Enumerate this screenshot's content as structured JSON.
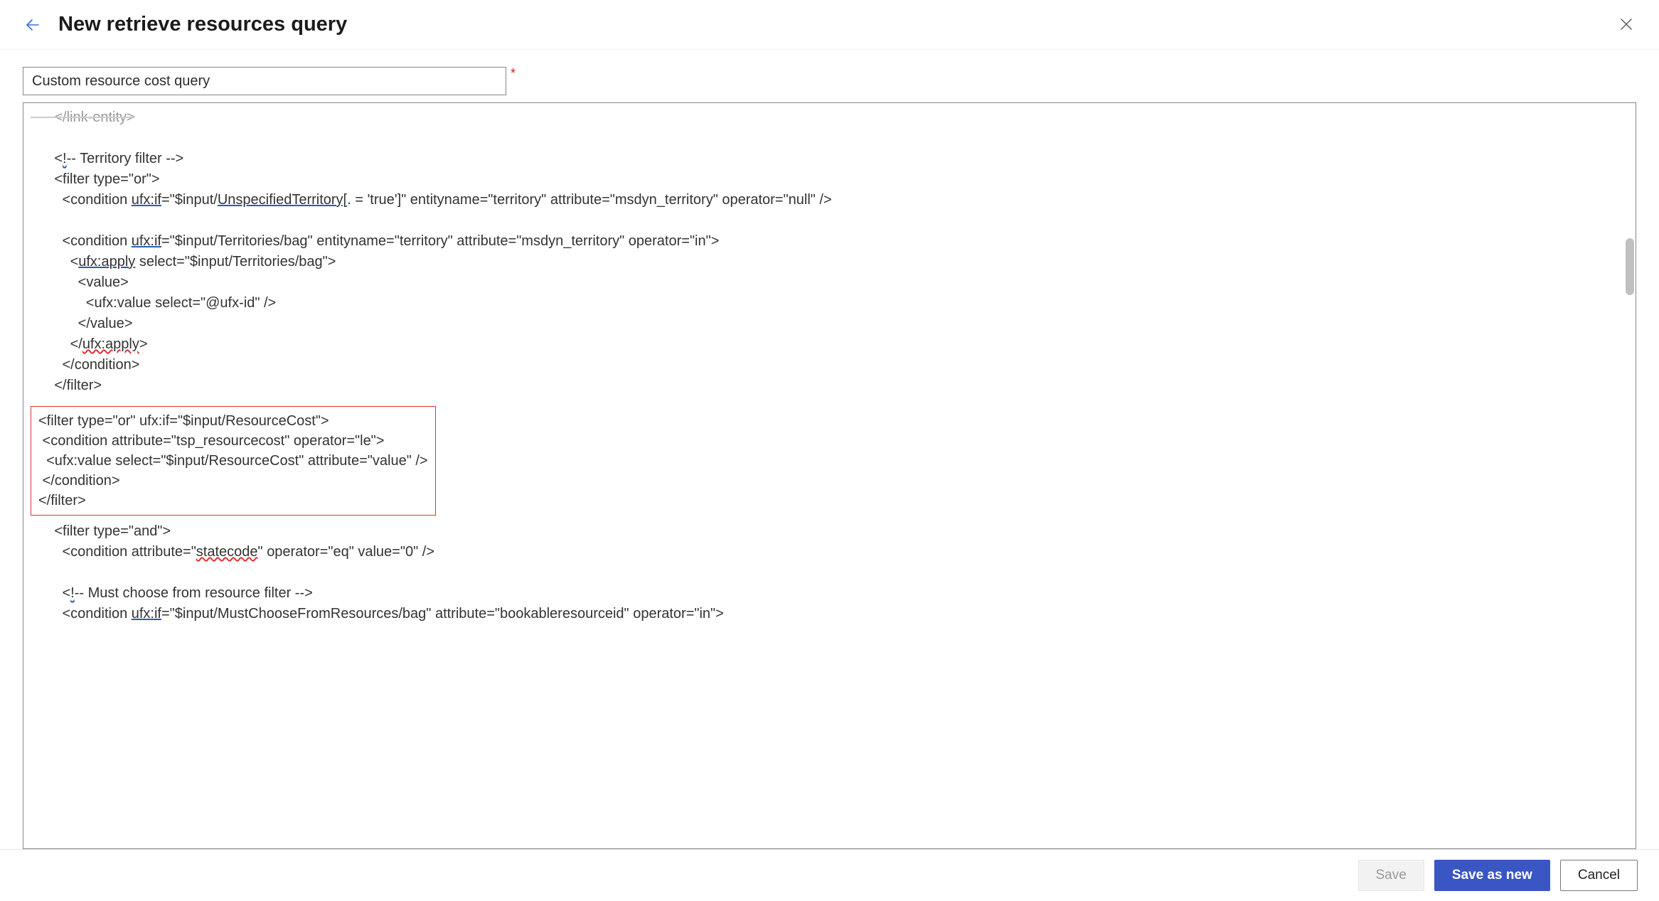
{
  "header": {
    "title": "New retrieve resources query"
  },
  "form": {
    "name_value": "Custom resource cost query"
  },
  "code": {
    "lines": {
      "l0": "      </link-entity>",
      "l1": "",
      "l2a": "      <",
      "l2b": "!",
      "l2c": "-- Territory filter -->",
      "l3": "      <filter type=\"or\">",
      "l4a": "        <condition ",
      "l4b": "ufx:if",
      "l4c": "=\"$input/",
      "l4d": "UnspecifiedTerritory[",
      "l4e": ". = 'true']\" entityname=\"territory\" attribute=\"msdyn_territory\" operator=\"null\" />",
      "l5": "",
      "l6a": "        <condition ",
      "l6b": "ufx:if",
      "l6c": "=\"$input/Territories/bag\" entityname=\"territory\" attribute=\"msdyn_territory\" operator=\"in\">",
      "l7a": "          <",
      "l7b": "ufx:apply",
      "l7c": " select=\"$input/Territories/bag\">",
      "l8": "            <value>",
      "l9": "              <ufx:value select=\"@ufx-id\" />",
      "l10": "            </value>",
      "l11a": "          </",
      "l11b": "ufx:apply",
      "l11c": ">",
      "l12": "        </condition>",
      "l13": "      </filter>",
      "hb1": "<filter type=\"or\" ufx:if=\"$input/ResourceCost\">",
      "hb2": " <condition attribute=\"tsp_resourcecost\" operator=\"le\">",
      "hb3": "  <ufx:value select=\"$input/ResourceCost\" attribute=\"value\" />",
      "hb4": " </condition>",
      "hb5": "</filter>",
      "l20": "      <filter type=\"and\">",
      "l21a": "        <condition attribute=\"",
      "l21b": "statecode",
      "l21c": "\" operator=\"eq\" value=\"0\" />",
      "l22": "",
      "l23a": "        <",
      "l23b": "!",
      "l23c": "-- Must choose from resource filter -->",
      "l24a": "        <condition ",
      "l24b": "ufx:if",
      "l24c": "=\"$input/MustChooseFromResources/bag\" attribute=\"bookableresourceid\" operator=\"in\">"
    }
  },
  "footer": {
    "save_label": "Save",
    "save_as_new_label": "Save as new",
    "cancel_label": "Cancel"
  }
}
